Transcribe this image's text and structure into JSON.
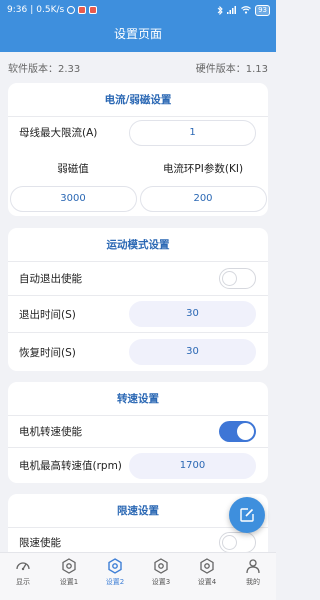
{
  "status": {
    "time": "9:36",
    "speed": "0.5K/s",
    "battery": "93"
  },
  "appbar": {
    "title": "设置页面"
  },
  "versions": {
    "software": "软件版本：2.33",
    "hardware": "硬件版本：1.13"
  },
  "current_card": {
    "title": "电流/弱磁设置",
    "bus_max_current_label": "母线最大限流(A)",
    "bus_max_current_value": "1",
    "field_weakening_label": "弱磁值",
    "field_weakening_value": "3000",
    "current_loop_pi_label": "电流环PI参数(KI)",
    "current_loop_pi_value": "200"
  },
  "motion_card": {
    "title": "运动模式设置",
    "auto_exit_label": "自动退出使能",
    "auto_exit_enabled": false,
    "exit_time_label": "退出时间(S)",
    "exit_time_value": "30",
    "recovery_time_label": "恢复时间(S)",
    "recovery_time_value": "30"
  },
  "speed_card": {
    "title": "转速设置",
    "motor_speed_enable_label": "电机转速使能",
    "motor_speed_enabled": true,
    "max_speed_label": "电机最高转速值(rpm)",
    "max_speed_value": "1700"
  },
  "limit_card": {
    "title": "限速设置",
    "limit_enable_label": "限速使能",
    "limit_enabled": false
  },
  "nav": {
    "items": [
      {
        "label": "显示",
        "icon": "speedometer-icon",
        "active": false
      },
      {
        "label": "设置1",
        "icon": "hexagon-gear-icon",
        "active": false
      },
      {
        "label": "设置2",
        "icon": "hexagon-gear-icon",
        "active": true
      },
      {
        "label": "设置3",
        "icon": "hexagon-gear-icon",
        "active": false
      },
      {
        "label": "设置4",
        "icon": "hexagon-gear-icon",
        "active": false
      },
      {
        "label": "我的",
        "icon": "person-icon",
        "active": false
      }
    ]
  },
  "colors": {
    "primary": "#3e8fdd",
    "title_text": "#2b68b4",
    "toggle_on": "#3e76d6",
    "nav_active": "#3e7fd6"
  }
}
